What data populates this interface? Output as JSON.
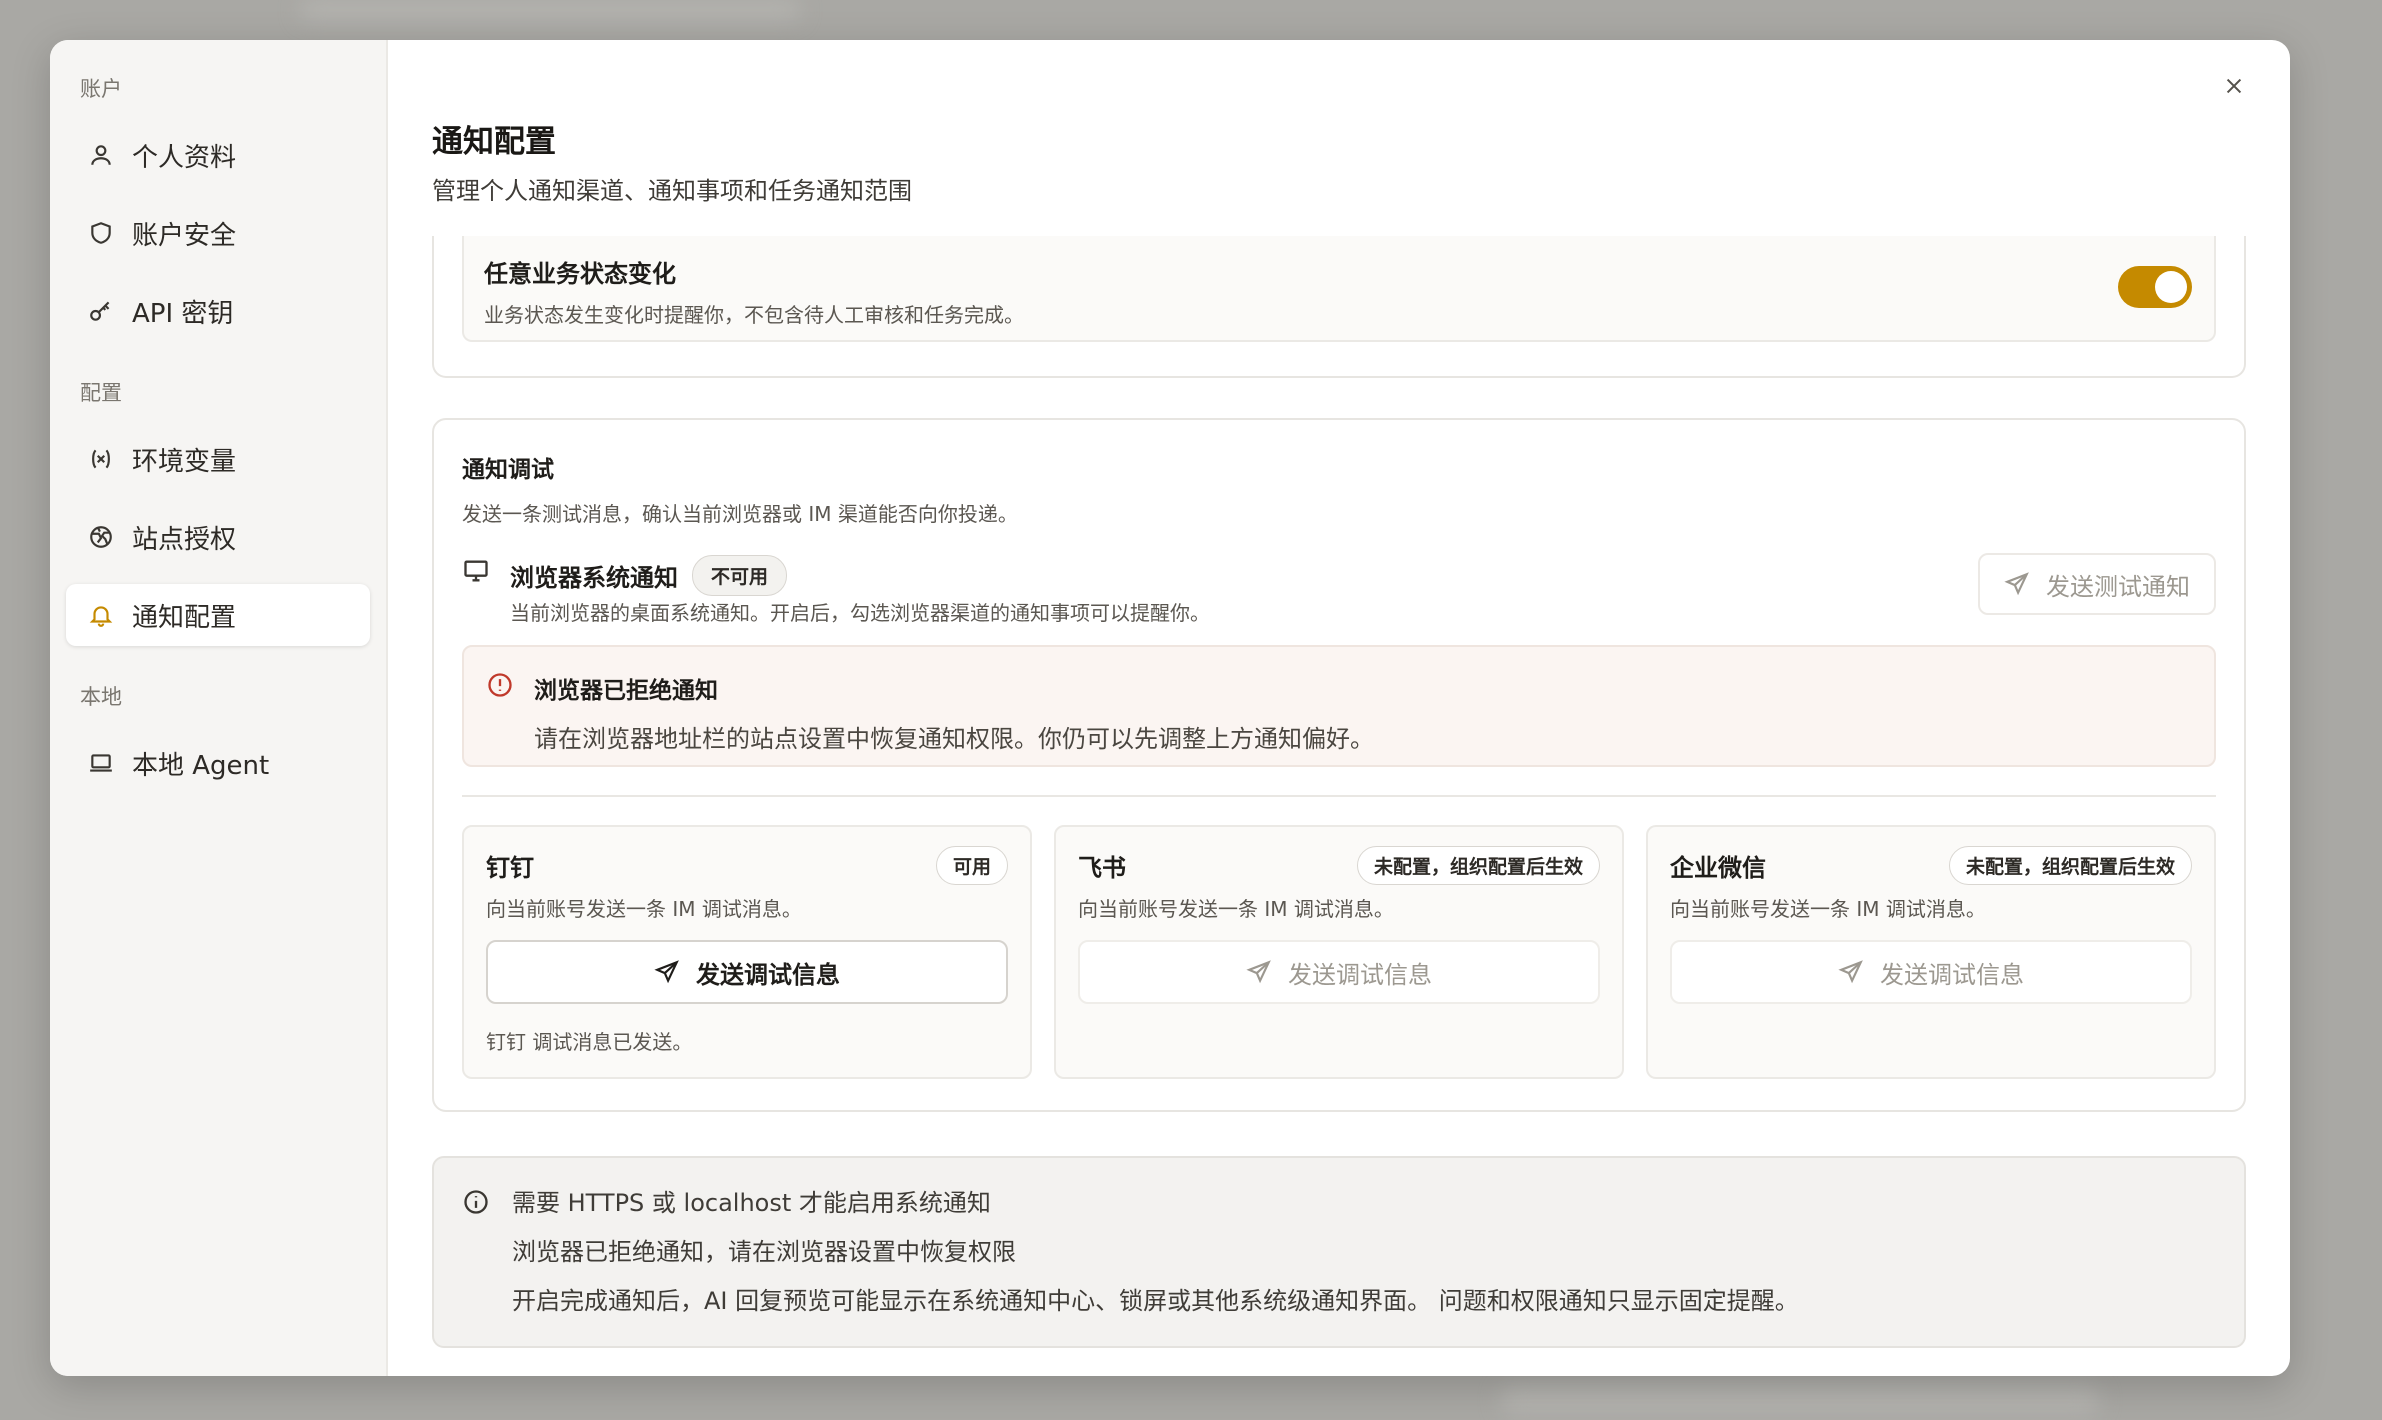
{
  "sidebar": {
    "sections": [
      {
        "label": "账户",
        "items": [
          {
            "label": "个人资料",
            "icon": "user-icon"
          },
          {
            "label": "账户安全",
            "icon": "shield-icon"
          },
          {
            "label": "API 密钥",
            "icon": "key-icon"
          }
        ]
      },
      {
        "label": "配置",
        "items": [
          {
            "label": "环境变量",
            "icon": "variable-icon"
          },
          {
            "label": "站点授权",
            "icon": "globe-icon"
          },
          {
            "label": "通知配置",
            "icon": "bell-icon",
            "active": true
          }
        ]
      },
      {
        "label": "本地",
        "items": [
          {
            "label": "本地 Agent",
            "icon": "laptop-icon"
          }
        ]
      }
    ]
  },
  "header": {
    "title": "通知配置",
    "subtitle": "管理个人通知渠道、通知事项和任务通知范围"
  },
  "status_change": {
    "title": "任意业务状态变化",
    "desc": "业务状态发生变化时提醒你，不包含待人工审核和任务完成。",
    "enabled": true
  },
  "debug": {
    "title": "通知调试",
    "desc": "发送一条测试消息，确认当前浏览器或 IM 渠道能否向你投递。",
    "browser": {
      "title": "浏览器系统通知",
      "badge": "不可用",
      "desc": "当前浏览器的桌面系统通知。开启后，勾选浏览器渠道的通知事项可以提醒你。",
      "button": "发送测试通知"
    },
    "alert": {
      "title": "浏览器已拒绝通知",
      "desc": "请在浏览器地址栏的站点设置中恢复通知权限。你仍可以先调整上方通知偏好。"
    },
    "im": [
      {
        "name": "钉钉",
        "badge": "可用",
        "desc": "向当前账号发送一条 IM 调试消息。",
        "button": "发送调试信息",
        "status": "钉钉 调试消息已发送。"
      },
      {
        "name": "飞书",
        "badge": "未配置，组织配置后生效",
        "desc": "向当前账号发送一条 IM 调试消息。",
        "button": "发送调试信息",
        "status": ""
      },
      {
        "name": "企业微信",
        "badge": "未配置，组织配置后生效",
        "desc": "向当前账号发送一条 IM 调试消息。",
        "button": "发送调试信息",
        "status": ""
      }
    ]
  },
  "info": {
    "lines": [
      "需要 HTTPS 或 localhost 才能启用系统通知",
      "浏览器已拒绝通知，请在浏览器设置中恢复权限",
      "开启完成通知后，AI 回复预览可能显示在系统通知中心、锁屏或其他系统级通知界面。 问题和权限通知只显示固定提醒。"
    ]
  },
  "colors": {
    "accent": "#c58a00",
    "alert": "#c0392b"
  }
}
